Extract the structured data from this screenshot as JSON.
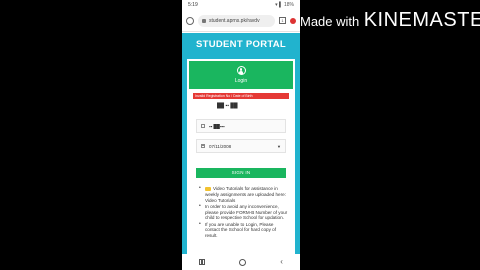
{
  "status_bar": {
    "time": "5:19",
    "right": "▾ ▌ 18%"
  },
  "browser": {
    "url": "student.aprns.pk/ravdv",
    "tabs_count": "1"
  },
  "portal": {
    "title": "STUDENT PORTAL",
    "login_label": "Login",
    "alert_text": "Invalid Registration No / Date of Birth",
    "masked_value": "██ ▪▪ ██",
    "reg_field_value": "▪▪ ██▪▪▪",
    "dob_value": "07/11/2008",
    "signin_label": "SIGN IN",
    "notes": [
      "Video Tutorials for assistance in weekly assignments are uploaded here: Video Tutorials",
      "In order to avoid any inconvenience, please provide FORM-B Number of your child to respective School for updation.",
      "If you are unable to Login, Please contact the School for hard copy of result."
    ]
  },
  "watermark": {
    "made_with": "Made with",
    "brand": "KINEMASTER"
  },
  "colors": {
    "page_bg": "#21b3ce",
    "login_green": "#1ab65f",
    "alert_red": "#e53935"
  },
  "icons": [
    "home-icon",
    "lock-icon",
    "tabs-icon",
    "menu-icon",
    "user-icon",
    "id-card-icon",
    "calendar-icon",
    "chevron-down-icon"
  ]
}
